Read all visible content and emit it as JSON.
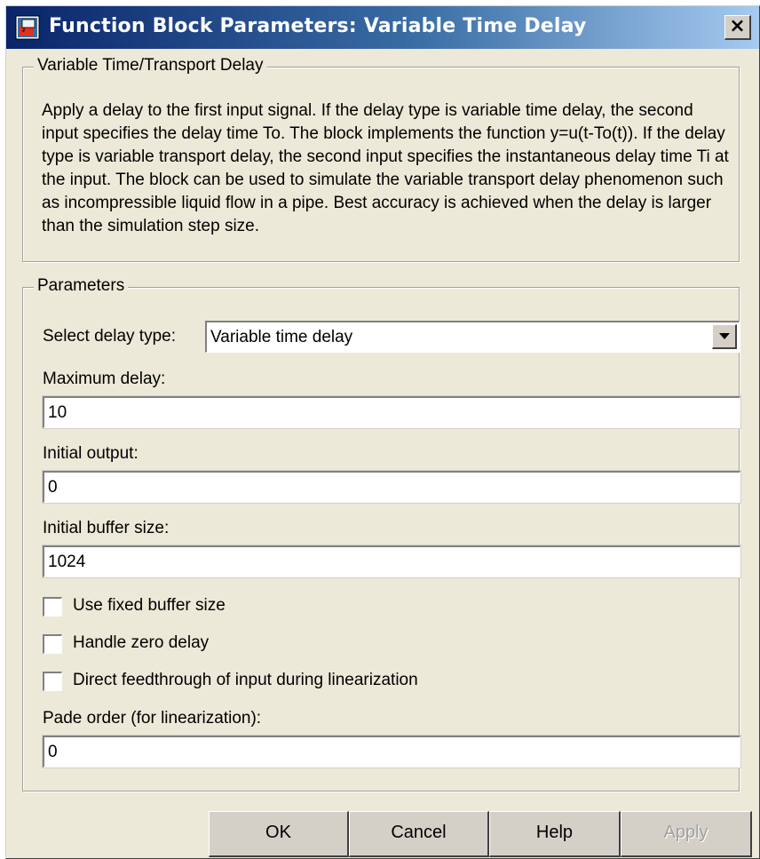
{
  "window": {
    "title": "Function Block Parameters: Variable Time Delay",
    "close_label": "×"
  },
  "description": {
    "group_title": "Variable Time/Transport Delay",
    "text": "Apply a delay to the first input signal.  If the delay type is variable time delay, the second input specifies the delay time To. The block implements the function y=u(t-To(t)). If the delay type is variable transport delay, the second input specifies the instantaneous delay time Ti at the input. The block can be used to simulate the variable transport delay phenomenon such as incompressible liquid flow in a pipe. Best accuracy is achieved when the delay is larger than the simulation step size."
  },
  "parameters": {
    "group_title": "Parameters",
    "delay_type": {
      "label": "Select delay type:",
      "value": "Variable time delay"
    },
    "maximum_delay": {
      "label": "Maximum delay:",
      "value": "10"
    },
    "initial_output": {
      "label": "Initial output:",
      "value": "0"
    },
    "initial_buffer_size": {
      "label": "Initial buffer size:",
      "value": "1024"
    },
    "use_fixed_buffer_size": {
      "label": "Use fixed buffer size",
      "checked": false
    },
    "handle_zero_delay": {
      "label": "Handle zero delay",
      "checked": false
    },
    "direct_feedthrough": {
      "label": "Direct feedthrough of input during linearization",
      "checked": false
    },
    "pade_order": {
      "label": "Pade order (for linearization):",
      "value": "0"
    }
  },
  "buttons": {
    "ok": "OK",
    "cancel": "Cancel",
    "help": "Help",
    "apply": "Apply"
  },
  "icons": {
    "app": "simulink-block-icon",
    "close": "close-icon",
    "dropdown": "chevron-down-icon"
  }
}
